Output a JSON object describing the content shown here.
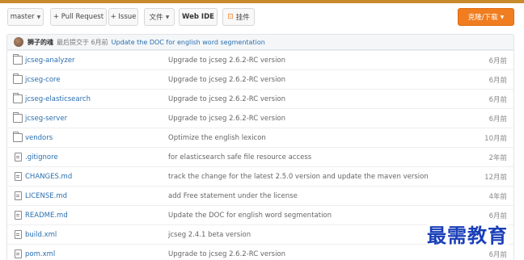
{
  "toolbar": {
    "branch_label": "master",
    "pull_request_label": "+ Pull Request",
    "issue_label": "+ Issue",
    "files_label": "文件",
    "web_ide_label": "Web IDE",
    "widget_label": "挂件",
    "clone_label": "克隆/下载"
  },
  "commit": {
    "author": "狮子的魂",
    "meta": "最后提交于 6月前",
    "message": "Update the DOC for english word segmentation"
  },
  "files": [
    {
      "type": "folder",
      "name": "jcseg-analyzer",
      "message": "Upgrade to jcseg 2.6.2-RC version",
      "age": "6月前"
    },
    {
      "type": "folder",
      "name": "jcseg-core",
      "message": "Upgrade to jcseg 2.6.2-RC version",
      "age": "6月前"
    },
    {
      "type": "folder",
      "name": "jcseg-elasticsearch",
      "message": "Upgrade to jcseg 2.6.2-RC version",
      "age": "6月前"
    },
    {
      "type": "folder",
      "name": "jcseg-server",
      "message": "Upgrade to jcseg 2.6.2-RC version",
      "age": "6月前"
    },
    {
      "type": "folder",
      "name": "vendors",
      "message": "Optimize the english lexicon",
      "age": "10月前"
    },
    {
      "type": "file",
      "name": ".gitignore",
      "message": "for elasticsearch safe file resource access",
      "age": "2年前"
    },
    {
      "type": "file",
      "name": "CHANGES.md",
      "message": "track the change for the latest 2.5.0 version and update the maven version",
      "age": "12月前"
    },
    {
      "type": "file",
      "name": "LICENSE.md",
      "message": "add Free statement under the license",
      "age": "4年前"
    },
    {
      "type": "file",
      "name": "README.md",
      "message": "Update the DOC for english word segmentation",
      "age": "6月前"
    },
    {
      "type": "file",
      "name": "build.xml",
      "message": "jcseg 2.4.1 beta version",
      "age": ""
    },
    {
      "type": "file",
      "name": "pom.xml",
      "message": "Upgrade to jcseg 2.6.2-RC version",
      "age": "6月前"
    }
  ],
  "watermark": "最需教育",
  "colors": {
    "accent": "#f07d1f",
    "link": "#2a6fb0",
    "watermark": "#1a3fb8"
  }
}
